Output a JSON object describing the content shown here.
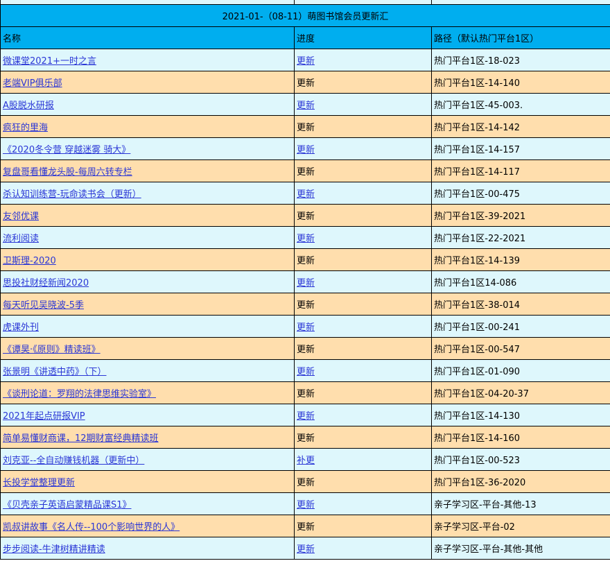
{
  "title": "2021-01-（08-11）萌图书馆会员更新汇",
  "headers": [
    "名称",
    "进度",
    "路径（默认热门平台1区）"
  ],
  "colors": {
    "title_bg": "#00aeef",
    "row_blue": "#def7fc",
    "row_peach": "#ffdead",
    "link": "#2a36d6"
  },
  "rows": [
    {
      "name": "微课堂2021+一时之言",
      "progress": "更新",
      "progress_link": true,
      "path": "热门平台1区-18-023"
    },
    {
      "name": "老端VIP俱乐部",
      "progress": "更新",
      "progress_link": false,
      "path": "热门平台1区-14-140"
    },
    {
      "name": "A股脱水研报",
      "progress": "更新",
      "progress_link": true,
      "path": "热门平台1区-45-003."
    },
    {
      "name": "疯狂的里海",
      "progress": "更新",
      "progress_link": false,
      "path": "热门平台1区-14-142"
    },
    {
      "name": "《2020冬令营 穿越迷雾 骑大》",
      "progress": "更新",
      "progress_link": true,
      "path": "热门平台1区-14-157"
    },
    {
      "name": "复盘哥看懂龙头股-每周六转专栏",
      "progress": "更新",
      "progress_link": false,
      "path": "热门平台1区-14-117"
    },
    {
      "name": "杀认知训练营-玩命读书会（更新）",
      "progress": "更新",
      "progress_link": true,
      "path": "热门平台1区-00-475"
    },
    {
      "name": "友邻优课",
      "progress": "更新",
      "progress_link": false,
      "path": "热门平台1区-39-2021"
    },
    {
      "name": "流利阅读",
      "progress": "更新",
      "progress_link": true,
      "path": "热门平台1区-22-2021"
    },
    {
      "name": "卫斯理-2020",
      "progress": "更新",
      "progress_link": false,
      "path": "热门平台1区-14-139"
    },
    {
      "name": "思投社财经新闻2020",
      "progress": "更新",
      "progress_link": true,
      "path": "热门平台1区14-086"
    },
    {
      "name": "每天听见吴晓波-5季",
      "progress": "更新",
      "progress_link": false,
      "path": "热门平台1区-38-014"
    },
    {
      "name": "虎课外刊",
      "progress": "更新",
      "progress_link": true,
      "path": "热门平台1区-00-241"
    },
    {
      "name": "《谭昊·《原则》精读班》",
      "progress": "更新",
      "progress_link": false,
      "path": "热门平台1区-00-547"
    },
    {
      "name": "张景明《讲透中药》（下）",
      "progress": "更新",
      "progress_link": true,
      "path": "热门平台1区-01-090"
    },
    {
      "name": "《谈刑论道：罗翔的法律思维实验室》",
      "progress": "更新",
      "progress_link": false,
      "path": "热门平台1区-04-20-37"
    },
    {
      "name": "2021年起点研报VIP",
      "progress": "更新",
      "progress_link": true,
      "path": "热门平台1区-14-130"
    },
    {
      "name": "简单易懂财商课，12期财富经典精读班",
      "progress": "更新",
      "progress_link": false,
      "path": "热门平台1区-14-160"
    },
    {
      "name": "刘克亚--全自动赚钱机器（更新中）",
      "progress": "补更",
      "progress_link": true,
      "path": "热门平台1区-00-523"
    },
    {
      "name": "长投学堂整理更新",
      "progress": "更新",
      "progress_link": false,
      "path": "热门平台1区-36-2020"
    },
    {
      "name": "《贝壳亲子英语启蒙精品课S1》",
      "progress": "更新",
      "progress_link": true,
      "path": "亲子学习区-平台-其他-13"
    },
    {
      "name": "凯叔讲故事《名人传--100个影响世界的人》",
      "progress": "更新",
      "progress_link": false,
      "path": "亲子学习区-平台-02"
    },
    {
      "name": "步步阅读-牛津树精讲精读",
      "progress": "更新",
      "progress_link": true,
      "path": "亲子学习区-平台-其他-其他"
    }
  ]
}
